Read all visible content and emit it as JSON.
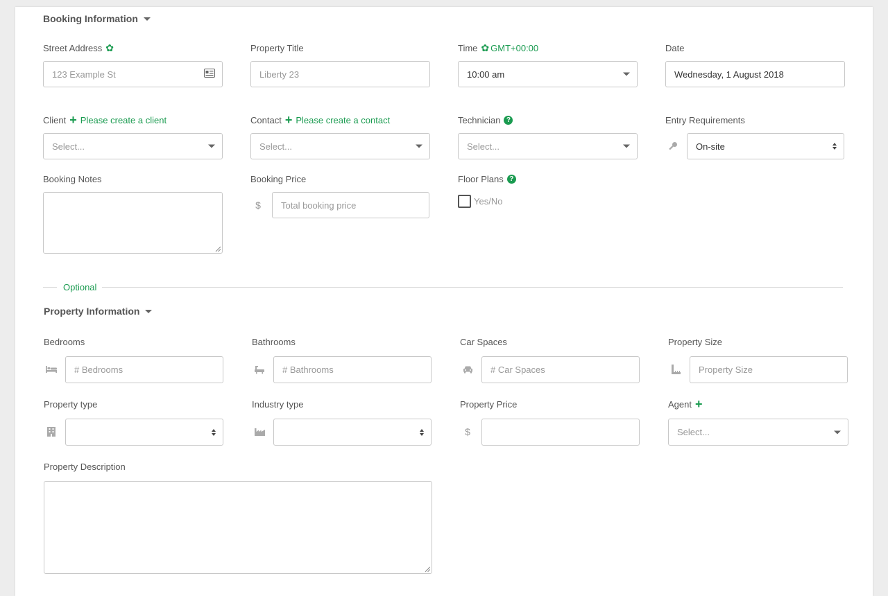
{
  "booking": {
    "section_title": "Booking Information",
    "street_address": {
      "label": "Street Address",
      "placeholder": "123 Example St"
    },
    "property_title": {
      "label": "Property Title",
      "placeholder": "Liberty 23"
    },
    "time": {
      "label": "Time",
      "timezone": "GMT+00:00",
      "value": "10:00 am"
    },
    "date": {
      "label": "Date",
      "value": "Wednesday, 1 August 2018"
    },
    "client": {
      "label": "Client",
      "link": "Please create a client",
      "placeholder": "Select..."
    },
    "contact": {
      "label": "Contact",
      "link": "Please create a contact",
      "placeholder": "Select..."
    },
    "technician": {
      "label": "Technician",
      "placeholder": "Select..."
    },
    "entry_requirements": {
      "label": "Entry Requirements",
      "value": "On-site"
    },
    "booking_notes": {
      "label": "Booking Notes"
    },
    "booking_price": {
      "label": "Booking Price",
      "currency": "$",
      "placeholder": "Total booking price"
    },
    "floor_plans": {
      "label": "Floor Plans",
      "checkbox_label": "Yes/No"
    }
  },
  "divider": {
    "label": "Optional"
  },
  "property": {
    "section_title": "Property Information",
    "bedrooms": {
      "label": "Bedrooms",
      "placeholder": "# Bedrooms",
      "icon": "bed-icon"
    },
    "bathrooms": {
      "label": "Bathrooms",
      "placeholder": "# Bathrooms",
      "icon": "bath-icon"
    },
    "car_spaces": {
      "label": "Car Spaces",
      "placeholder": "# Car Spaces",
      "icon": "car-icon"
    },
    "property_size": {
      "label": "Property Size",
      "placeholder": "Property Size",
      "icon": "ruler-icon"
    },
    "property_type": {
      "label": "Property type",
      "value": "",
      "icon": "building-icon"
    },
    "industry_type": {
      "label": "Industry type",
      "value": "",
      "icon": "industry-icon"
    },
    "property_price": {
      "label": "Property Price",
      "currency": "$"
    },
    "agent": {
      "label": "Agent",
      "placeholder": "Select..."
    },
    "property_description": {
      "label": "Property Description"
    }
  },
  "colors": {
    "accent": "#1a9b50",
    "border": "#c8c8c8",
    "text": "#555555",
    "placeholder": "#999999"
  }
}
